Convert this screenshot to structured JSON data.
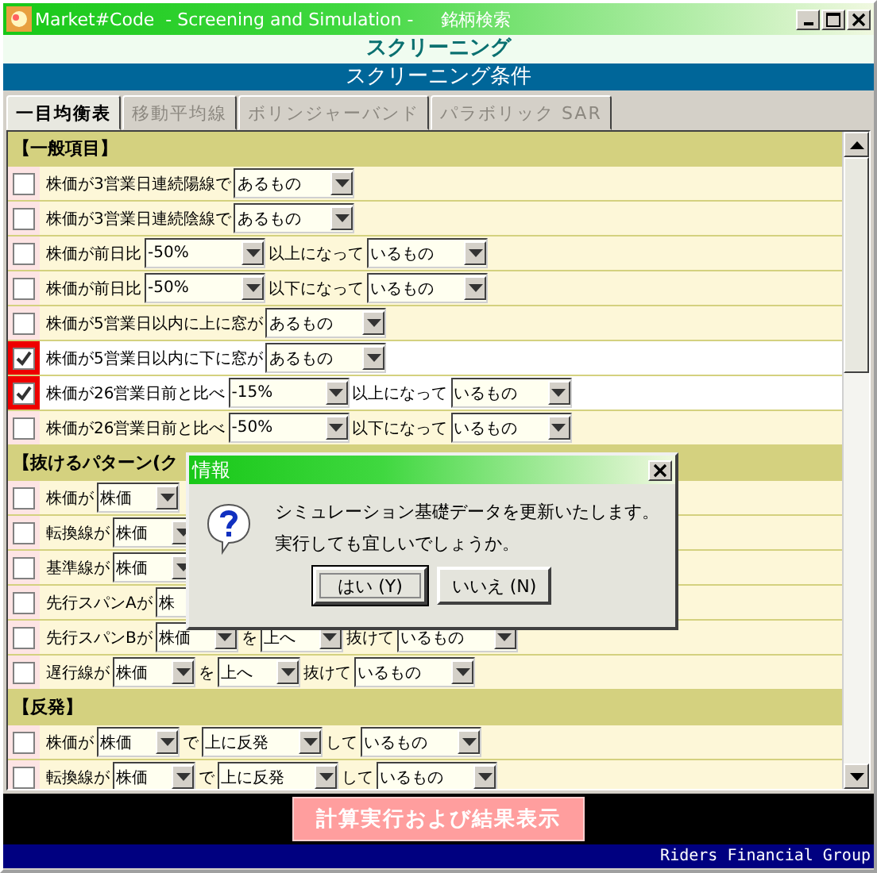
{
  "window": {
    "title": "Market#Code  - Screening and Simulation -     銘柄検索"
  },
  "heading": "スクリーニング",
  "band": "スクリーニング条件",
  "tabs": [
    {
      "label": "一目均衡表",
      "selected": true,
      "disabled": false
    },
    {
      "label": "移動平均線",
      "selected": false,
      "disabled": true
    },
    {
      "label": "ボリンジャーバンド",
      "selected": false,
      "disabled": true
    },
    {
      "label": "パラボリック SAR",
      "selected": false,
      "disabled": true
    }
  ],
  "sections": [
    {
      "title": "【一般項目】",
      "rows": [
        {
          "checked": false,
          "parts": [
            {
              "kind": "text",
              "text": "株価が3営業日連続陽線で"
            },
            {
              "kind": "select",
              "value": "あるもの"
            }
          ]
        },
        {
          "checked": false,
          "parts": [
            {
              "kind": "text",
              "text": "株価が3営業日連続陰線で"
            },
            {
              "kind": "select",
              "value": "あるもの"
            }
          ]
        },
        {
          "checked": false,
          "parts": [
            {
              "kind": "text",
              "text": "株価が前日比"
            },
            {
              "kind": "select",
              "value": "-50%"
            },
            {
              "kind": "text",
              "text": "以上になって"
            },
            {
              "kind": "select",
              "value": "いるもの"
            }
          ]
        },
        {
          "checked": false,
          "parts": [
            {
              "kind": "text",
              "text": "株価が前日比"
            },
            {
              "kind": "select",
              "value": "-50%"
            },
            {
              "kind": "text",
              "text": "以下になって"
            },
            {
              "kind": "select",
              "value": "いるもの"
            }
          ]
        },
        {
          "checked": false,
          "parts": [
            {
              "kind": "text",
              "text": "株価が5営業日以内に上に窓が"
            },
            {
              "kind": "select",
              "value": "あるもの"
            }
          ]
        },
        {
          "checked": true,
          "parts": [
            {
              "kind": "text",
              "text": "株価が5営業日以内に下に窓が"
            },
            {
              "kind": "select",
              "value": "あるもの"
            }
          ]
        },
        {
          "checked": true,
          "parts": [
            {
              "kind": "text",
              "text": "株価が26営業日前と比べ"
            },
            {
              "kind": "select",
              "value": "-15%"
            },
            {
              "kind": "text",
              "text": "以上になって"
            },
            {
              "kind": "select",
              "value": "いるもの"
            }
          ]
        },
        {
          "checked": false,
          "parts": [
            {
              "kind": "text",
              "text": "株価が26営業日前と比べ"
            },
            {
              "kind": "select",
              "value": "-50%"
            },
            {
              "kind": "text",
              "text": "以下になって"
            },
            {
              "kind": "select",
              "value": "いるもの"
            }
          ]
        }
      ]
    },
    {
      "title": "【抜けるパターン(ク",
      "rows": [
        {
          "checked": false,
          "parts": [
            {
              "kind": "text",
              "text": "株価が"
            },
            {
              "kind": "select",
              "value": "株価"
            }
          ]
        },
        {
          "checked": false,
          "parts": [
            {
              "kind": "text",
              "text": "転換線が"
            },
            {
              "kind": "select",
              "value": "株価"
            }
          ]
        },
        {
          "checked": false,
          "parts": [
            {
              "kind": "text",
              "text": "基準線が"
            },
            {
              "kind": "select",
              "value": "株価"
            }
          ]
        },
        {
          "checked": false,
          "parts": [
            {
              "kind": "text",
              "text": "先行スパンAが"
            },
            {
              "kind": "covered-select",
              "value": "株"
            }
          ]
        },
        {
          "checked": false,
          "parts": [
            {
              "kind": "text",
              "text": "先行スパンBが"
            },
            {
              "kind": "select",
              "value": "株価"
            },
            {
              "kind": "text",
              "text": "を"
            },
            {
              "kind": "select",
              "value": "上へ"
            },
            {
              "kind": "text",
              "text": "抜けて"
            },
            {
              "kind": "select",
              "value": "いるもの"
            }
          ]
        },
        {
          "checked": false,
          "parts": [
            {
              "kind": "text",
              "text": "遅行線が"
            },
            {
              "kind": "select",
              "value": "株価"
            },
            {
              "kind": "text",
              "text": "を"
            },
            {
              "kind": "select",
              "value": "上へ"
            },
            {
              "kind": "text",
              "text": "抜けて"
            },
            {
              "kind": "select",
              "value": "いるもの"
            }
          ]
        }
      ]
    },
    {
      "title": "【反発】",
      "rows": [
        {
          "checked": false,
          "parts": [
            {
              "kind": "text",
              "text": "株価が"
            },
            {
              "kind": "select",
              "value": "株価"
            },
            {
              "kind": "text",
              "text": "で"
            },
            {
              "kind": "select",
              "value": "上に反発"
            },
            {
              "kind": "text",
              "text": "して"
            },
            {
              "kind": "select",
              "value": "いるもの"
            }
          ]
        },
        {
          "checked": false,
          "parts": [
            {
              "kind": "text",
              "text": "転換線が"
            },
            {
              "kind": "select",
              "value": "株価"
            },
            {
              "kind": "text",
              "text": "で"
            },
            {
              "kind": "select",
              "value": "上に反発"
            },
            {
              "kind": "text",
              "text": "して"
            },
            {
              "kind": "select",
              "value": "いるもの"
            }
          ]
        }
      ]
    }
  ],
  "dialog": {
    "title": "情報",
    "lines": [
      "シミュレーション基礎データを更新いたします。",
      "実行しても宜しいでしょうか。"
    ],
    "buttons": [
      {
        "label": "はい (Y)",
        "selected": true
      },
      {
        "label": "いいえ (N)",
        "selected": false
      }
    ]
  },
  "run_button": "計算実行および結果表示",
  "status_bar": "Riders Financial Group"
}
